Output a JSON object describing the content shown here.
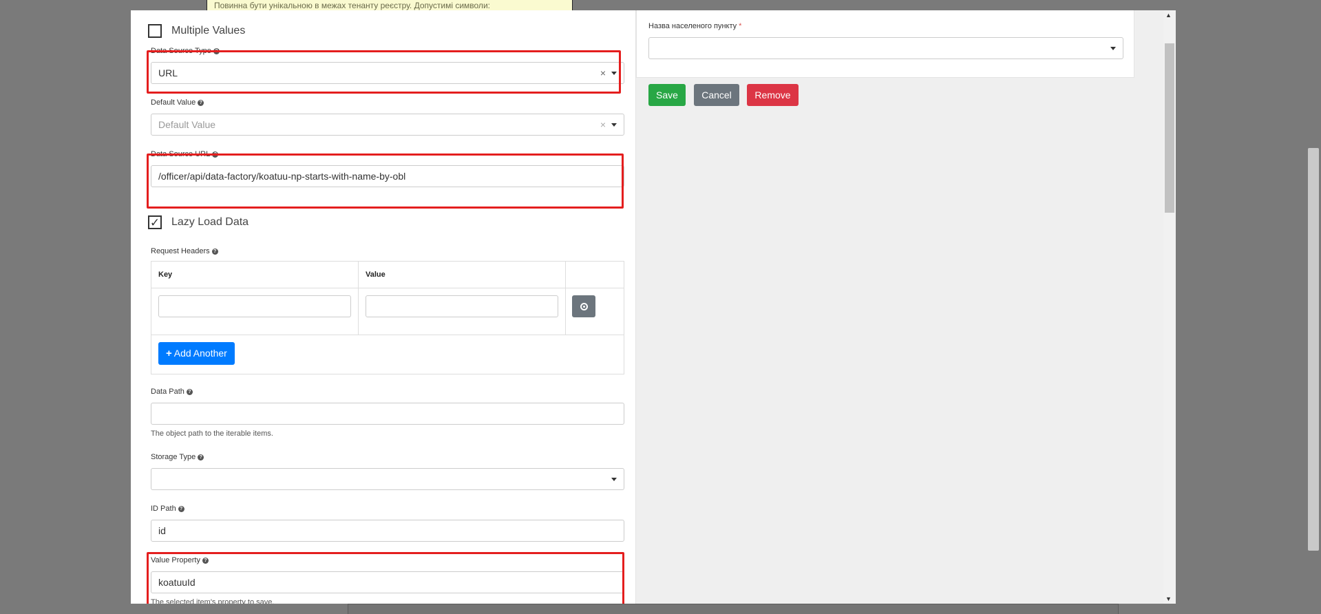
{
  "background": {
    "hint_text": "Повинна бути унікальною в межах тенанту реєстру. Допустимі символи:"
  },
  "left_form": {
    "multiple_values": {
      "label": "Multiple Values",
      "checked": false
    },
    "data_source_type": {
      "label": "Data Source Type",
      "value": "URL",
      "clear": "×"
    },
    "default_value": {
      "label": "Default Value",
      "placeholder": "Default Value",
      "clear": "×"
    },
    "data_source_url": {
      "label": "Data Source URL",
      "value": "/officer/api/data-factory/koatuu-np-starts-with-name-by-obl"
    },
    "lazy_load": {
      "label": "Lazy Load Data",
      "checked": true,
      "check_glyph": "✓"
    },
    "request_headers": {
      "label": "Request Headers",
      "columns": [
        "Key",
        "Value"
      ],
      "rows": [
        {
          "key": "",
          "value": ""
        }
      ],
      "add_label": "Add Another"
    },
    "data_path": {
      "label": "Data Path",
      "value": "",
      "hint": "The object path to the iterable items."
    },
    "storage_type": {
      "label": "Storage Type",
      "value": ""
    },
    "id_path": {
      "label": "ID Path",
      "value": "id"
    },
    "value_property": {
      "label": "Value Property",
      "value": "koatuuId",
      "hint": "The selected item's property to save."
    }
  },
  "right_preview": {
    "field_label": "Назва населеного пункту",
    "required_mark": "*",
    "value": "",
    "buttons": {
      "save": "Save",
      "cancel": "Cancel",
      "remove": "Remove"
    }
  },
  "colors": {
    "highlight": "#e41e1e",
    "save": "#28a745",
    "cancel": "#6c757d",
    "remove": "#dc3545",
    "add": "#007bff"
  },
  "icons": [
    "help-icon",
    "clear-icon",
    "dropdown-caret-icon",
    "checkbox-icon",
    "remove-circle-icon",
    "plus-icon",
    "scroll-up-icon",
    "scroll-down-icon"
  ]
}
